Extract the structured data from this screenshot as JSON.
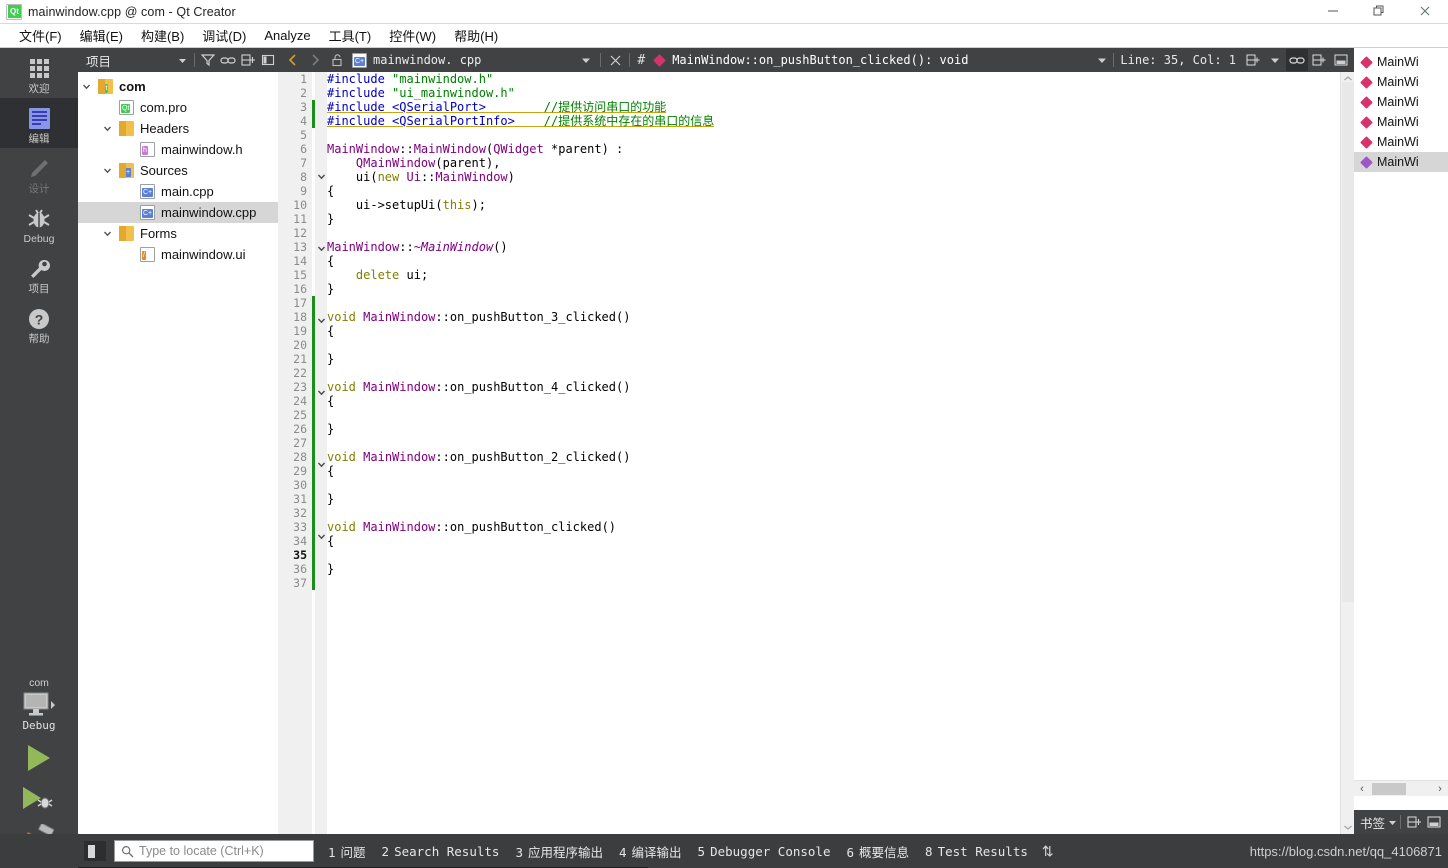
{
  "titlebar": {
    "title": "mainwindow.cpp @ com - Qt Creator",
    "app_icon": "qt-logo-icon",
    "minimize": "—",
    "maximize": "❐",
    "close": "✕"
  },
  "menubar": {
    "items": [
      {
        "label": "文件(F)",
        "name": "menu-file"
      },
      {
        "label": "编辑(E)",
        "name": "menu-edit"
      },
      {
        "label": "构建(B)",
        "name": "menu-build"
      },
      {
        "label": "调试(D)",
        "name": "menu-debug"
      },
      {
        "label": "Analyze",
        "name": "menu-analyze"
      },
      {
        "label": "工具(T)",
        "name": "menu-tools"
      },
      {
        "label": "控件(W)",
        "name": "menu-window"
      },
      {
        "label": "帮助(H)",
        "name": "menu-help"
      }
    ]
  },
  "modebar": {
    "items": [
      {
        "label": "欢迎",
        "icon": "grid-icon",
        "active": false,
        "disabled": false
      },
      {
        "label": "编辑",
        "icon": "edit-document-icon",
        "active": true,
        "disabled": false
      },
      {
        "label": "设计",
        "icon": "pencil-icon",
        "active": false,
        "disabled": true
      },
      {
        "label": "Debug",
        "icon": "bug-icon",
        "active": false,
        "disabled": false
      },
      {
        "label": "项目",
        "icon": "wrench-icon",
        "active": false,
        "disabled": false
      },
      {
        "label": "帮助",
        "icon": "question-mark-icon",
        "active": false,
        "disabled": false
      }
    ],
    "kit_name": "com",
    "kit_build": "Debug",
    "run_button": "run-icon",
    "debug_button": "debug-run-icon",
    "build_button": "hammer-icon"
  },
  "project_panel": {
    "title": "项目",
    "toolbar": [
      "filter-icon",
      "link-icon",
      "split-icon",
      "close-panel-icon"
    ],
    "tree": [
      {
        "label": "com",
        "indent": 0,
        "icon": "qt-project-icon",
        "expander": "expanded",
        "bold": true,
        "selected": false
      },
      {
        "label": "com.pro",
        "indent": 1,
        "icon": "qt-pro-file-icon",
        "expander": "none",
        "bold": false,
        "selected": false
      },
      {
        "label": "Headers",
        "indent": 1,
        "icon": "headers-folder-icon",
        "expander": "expanded",
        "bold": false,
        "selected": false
      },
      {
        "label": "mainwindow.h",
        "indent": 2,
        "icon": "h-file-icon",
        "expander": "none",
        "bold": false,
        "selected": false
      },
      {
        "label": "Sources",
        "indent": 1,
        "icon": "sources-folder-icon",
        "expander": "expanded",
        "bold": false,
        "selected": false
      },
      {
        "label": "main.cpp",
        "indent": 2,
        "icon": "cpp-file-icon",
        "expander": "none",
        "bold": false,
        "selected": false
      },
      {
        "label": "mainwindow.cpp",
        "indent": 2,
        "icon": "cpp-file-icon",
        "expander": "none",
        "bold": false,
        "selected": true
      },
      {
        "label": "Forms",
        "indent": 1,
        "icon": "forms-folder-icon",
        "expander": "expanded",
        "bold": false,
        "selected": false
      },
      {
        "label": "mainwindow.ui",
        "indent": 2,
        "icon": "ui-file-icon",
        "expander": "none",
        "bold": false,
        "selected": false
      }
    ]
  },
  "editor": {
    "nav_back": "back-arrow-icon",
    "nav_forward": "forward-arrow-icon",
    "lock": "unlocked-icon",
    "filename": "mainwindow. cpp",
    "file_icon": "cpp-file-icon",
    "close_tab": "close-icon",
    "hash": "#",
    "symbol": "MainWindow::on_pushButton_clicked(): void",
    "symbol_marker": "function-diamond-icon",
    "line_col": "Line: 35, Col: 1",
    "split_icon": "split-editor-icon",
    "sync_icon": "synchronize-icon",
    "split2_icon": "split-editor-icon",
    "close_split_icon": "close-split-icon",
    "lines": [
      {
        "n": 1,
        "fold": "",
        "mark": "",
        "tokens": [
          {
            "t": "#include ",
            "c": "t-pre"
          },
          {
            "t": "\"mainwindow.h\"",
            "c": "t-str"
          }
        ]
      },
      {
        "n": 2,
        "fold": "",
        "mark": "",
        "tokens": [
          {
            "t": "#include ",
            "c": "t-pre"
          },
          {
            "t": "\"ui_mainwindow.h\"",
            "c": "t-str"
          }
        ]
      },
      {
        "n": 3,
        "fold": "",
        "mark": "green",
        "warn": true,
        "tokens": [
          {
            "t": "#include ",
            "c": "t-pre"
          },
          {
            "t": "<QSerialPort>",
            "c": "t-pre"
          },
          {
            "t": "        ",
            "c": "t-plain"
          },
          {
            "t": "//提供访问串口的功能",
            "c": "t-cmt"
          }
        ]
      },
      {
        "n": 4,
        "fold": "",
        "mark": "green",
        "warn": true,
        "tokens": [
          {
            "t": "#include ",
            "c": "t-pre"
          },
          {
            "t": "<QSerialPortInfo>",
            "c": "t-pre"
          },
          {
            "t": "    ",
            "c": "t-plain"
          },
          {
            "t": "//提供系统中存在的串口的信息",
            "c": "t-cmt"
          }
        ]
      },
      {
        "n": 5,
        "fold": "",
        "mark": "",
        "tokens": []
      },
      {
        "n": 6,
        "fold": "",
        "mark": "",
        "tokens": [
          {
            "t": "MainWindow",
            "c": "t-type"
          },
          {
            "t": "::",
            "c": "t-plain"
          },
          {
            "t": "MainWindow",
            "c": "t-type"
          },
          {
            "t": "(",
            "c": "t-plain"
          },
          {
            "t": "QWidget",
            "c": "t-type"
          },
          {
            "t": " *parent",
            "c": "t-plain"
          },
          {
            "t": ") :",
            "c": "t-plain"
          }
        ]
      },
      {
        "n": 7,
        "fold": "",
        "mark": "",
        "tokens": [
          {
            "t": "    ",
            "c": "t-plain"
          },
          {
            "t": "QMainWindow",
            "c": "t-type"
          },
          {
            "t": "(parent),",
            "c": "t-plain"
          }
        ]
      },
      {
        "n": 8,
        "fold": "v",
        "mark": "",
        "tokens": [
          {
            "t": "    ui(",
            "c": "t-plain"
          },
          {
            "t": "new",
            "c": "t-kw"
          },
          {
            "t": " ",
            "c": "t-plain"
          },
          {
            "t": "Ui",
            "c": "t-type"
          },
          {
            "t": "::",
            "c": "t-plain"
          },
          {
            "t": "MainWindow",
            "c": "t-type"
          },
          {
            "t": ")",
            "c": "t-plain"
          }
        ]
      },
      {
        "n": 9,
        "fold": "",
        "mark": "",
        "tokens": [
          {
            "t": "{",
            "c": "t-plain"
          }
        ]
      },
      {
        "n": 10,
        "fold": "",
        "mark": "",
        "tokens": [
          {
            "t": "    ui->setupUi(",
            "c": "t-plain"
          },
          {
            "t": "this",
            "c": "t-kw"
          },
          {
            "t": ");",
            "c": "t-plain"
          }
        ]
      },
      {
        "n": 11,
        "fold": "",
        "mark": "",
        "tokens": [
          {
            "t": "}",
            "c": "t-plain"
          }
        ]
      },
      {
        "n": 12,
        "fold": "",
        "mark": "",
        "tokens": []
      },
      {
        "n": 13,
        "fold": "v",
        "mark": "",
        "tokens": [
          {
            "t": "MainWindow",
            "c": "t-type"
          },
          {
            "t": "::",
            "c": "t-plain"
          },
          {
            "t": "~MainWindow",
            "c": "t-type t-italic"
          },
          {
            "t": "()",
            "c": "t-plain"
          }
        ]
      },
      {
        "n": 14,
        "fold": "",
        "mark": "",
        "tokens": [
          {
            "t": "{",
            "c": "t-plain"
          }
        ]
      },
      {
        "n": 15,
        "fold": "",
        "mark": "",
        "tokens": [
          {
            "t": "    ",
            "c": "t-plain"
          },
          {
            "t": "delete",
            "c": "t-kw"
          },
          {
            "t": " ui;",
            "c": "t-plain"
          }
        ]
      },
      {
        "n": 16,
        "fold": "",
        "mark": "",
        "tokens": [
          {
            "t": "}",
            "c": "t-plain"
          }
        ]
      },
      {
        "n": 17,
        "fold": "",
        "mark": "green",
        "tokens": []
      },
      {
        "n": 18,
        "fold": "v",
        "mark": "green",
        "tokens": [
          {
            "t": "void",
            "c": "t-kw"
          },
          {
            "t": " ",
            "c": "t-plain"
          },
          {
            "t": "MainWindow",
            "c": "t-type"
          },
          {
            "t": "::",
            "c": "t-plain"
          },
          {
            "t": "on_pushButton_3_clicked",
            "c": "t-plain"
          },
          {
            "t": "()",
            "c": "t-plain"
          }
        ]
      },
      {
        "n": 19,
        "fold": "",
        "mark": "green",
        "tokens": [
          {
            "t": "{",
            "c": "t-plain"
          }
        ]
      },
      {
        "n": 20,
        "fold": "",
        "mark": "green",
        "tokens": []
      },
      {
        "n": 21,
        "fold": "",
        "mark": "green",
        "tokens": [
          {
            "t": "}",
            "c": "t-plain"
          }
        ]
      },
      {
        "n": 22,
        "fold": "",
        "mark": "green",
        "tokens": []
      },
      {
        "n": 23,
        "fold": "v",
        "mark": "green",
        "tokens": [
          {
            "t": "void",
            "c": "t-kw"
          },
          {
            "t": " ",
            "c": "t-plain"
          },
          {
            "t": "MainWindow",
            "c": "t-type"
          },
          {
            "t": "::",
            "c": "t-plain"
          },
          {
            "t": "on_pushButton_4_clicked",
            "c": "t-plain"
          },
          {
            "t": "()",
            "c": "t-plain"
          }
        ]
      },
      {
        "n": 24,
        "fold": "",
        "mark": "green",
        "tokens": [
          {
            "t": "{",
            "c": "t-plain"
          }
        ]
      },
      {
        "n": 25,
        "fold": "",
        "mark": "green",
        "tokens": []
      },
      {
        "n": 26,
        "fold": "",
        "mark": "green",
        "tokens": [
          {
            "t": "}",
            "c": "t-plain"
          }
        ]
      },
      {
        "n": 27,
        "fold": "",
        "mark": "green",
        "tokens": []
      },
      {
        "n": 28,
        "fold": "v",
        "mark": "green",
        "tokens": [
          {
            "t": "void",
            "c": "t-kw"
          },
          {
            "t": " ",
            "c": "t-plain"
          },
          {
            "t": "MainWindow",
            "c": "t-type"
          },
          {
            "t": "::",
            "c": "t-plain"
          },
          {
            "t": "on_pushButton_2_clicked",
            "c": "t-plain"
          },
          {
            "t": "()",
            "c": "t-plain"
          }
        ]
      },
      {
        "n": 29,
        "fold": "",
        "mark": "green",
        "tokens": [
          {
            "t": "{",
            "c": "t-plain"
          }
        ]
      },
      {
        "n": 30,
        "fold": "",
        "mark": "green",
        "tokens": []
      },
      {
        "n": 31,
        "fold": "",
        "mark": "green",
        "tokens": [
          {
            "t": "}",
            "c": "t-plain"
          }
        ]
      },
      {
        "n": 32,
        "fold": "",
        "mark": "green",
        "tokens": []
      },
      {
        "n": 33,
        "fold": "v",
        "mark": "green",
        "tokens": [
          {
            "t": "void",
            "c": "t-kw"
          },
          {
            "t": " ",
            "c": "t-plain"
          },
          {
            "t": "MainWindow",
            "c": "t-type"
          },
          {
            "t": "::",
            "c": "t-plain"
          },
          {
            "t": "on_pushButton_clicked",
            "c": "t-plain"
          },
          {
            "t": "()",
            "c": "t-plain"
          }
        ]
      },
      {
        "n": 34,
        "fold": "",
        "mark": "green",
        "tokens": [
          {
            "t": "{",
            "c": "t-plain"
          }
        ]
      },
      {
        "n": 35,
        "fold": "",
        "mark": "green",
        "current": true,
        "tokens": []
      },
      {
        "n": 36,
        "fold": "",
        "mark": "green",
        "tokens": [
          {
            "t": "}",
            "c": "t-plain"
          }
        ]
      },
      {
        "n": 37,
        "fold": "",
        "mark": "green",
        "tokens": []
      }
    ]
  },
  "outline": {
    "rows": [
      {
        "label": "MainWi",
        "marker": "pink",
        "selected": false
      },
      {
        "label": "MainWi",
        "marker": "pink",
        "selected": false
      },
      {
        "label": "MainWi",
        "marker": "pink",
        "selected": false
      },
      {
        "label": "MainWi",
        "marker": "pink",
        "selected": false
      },
      {
        "label": "MainWi",
        "marker": "pink",
        "selected": false
      },
      {
        "label": "MainWi",
        "marker": "purple",
        "selected": true
      }
    ],
    "scroll_left": "‹",
    "scroll_right": "›",
    "footer_title": "书签",
    "footer_icons": [
      "split-icon",
      "close-panel-icon"
    ]
  },
  "bottombar": {
    "sidebar_toggle": "toggle-sidebar-icon",
    "locator_placeholder": "Type to locate (Ctrl+K)",
    "locator_value": "",
    "locator_icon": "search-icon",
    "tabs": [
      {
        "num": "1",
        "label": "问题",
        "cjk": true
      },
      {
        "num": "2",
        "label": "Search Results",
        "cjk": false
      },
      {
        "num": "3",
        "label": "应用程序输出",
        "cjk": true
      },
      {
        "num": "4",
        "label": "编译输出",
        "cjk": true
      },
      {
        "num": "5",
        "label": "Debugger Console",
        "cjk": false
      },
      {
        "num": "6",
        "label": "概要信息",
        "cjk": true
      },
      {
        "num": "8",
        "label": "Test Results",
        "cjk": false
      }
    ],
    "resize_handle": "⇅",
    "watermark": "https://blog.csdn.net/qq_4106871"
  },
  "colors": {
    "chrome_dark": "#404244",
    "chrome_darker": "#2e3033",
    "bottom_bar": "#3b3d3f",
    "selection": "#d6d6d6",
    "accent_pink": "#d6336c",
    "accent_purple": "#9b59c4",
    "run_green": "#93b85a",
    "change_green": "#1a8f1a",
    "warn_underline": "#c8a415"
  }
}
